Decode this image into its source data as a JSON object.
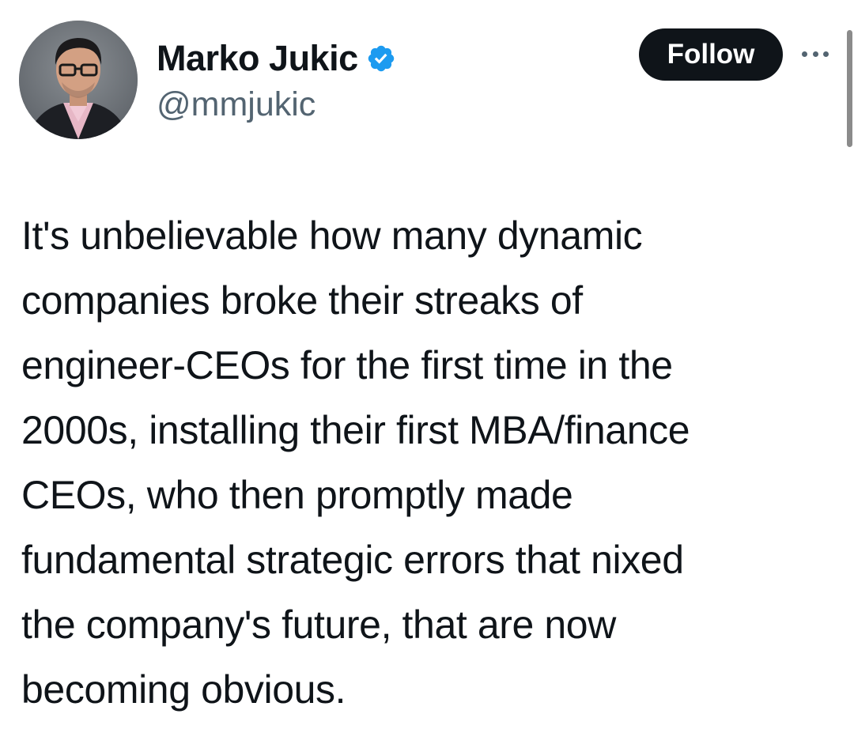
{
  "author": {
    "display_name": "Marko Jukic",
    "handle": "@mmjukic",
    "verified": true,
    "verified_icon": "verified-badge-icon",
    "verified_color": "#1d9bf0"
  },
  "actions": {
    "follow_label": "Follow",
    "more_icon": "more-horizontal-icon"
  },
  "tweet": {
    "lines": [
      "It's unbelievable how many dynamic",
      "companies broke their streaks of",
      "engineer-CEOs for the first time in the",
      "2000s, installing their first MBA/finance",
      "CEOs, who then promptly made",
      "fundamental strategic errors that nixed",
      "the company's future, that are now",
      "becoming obvious."
    ]
  },
  "colors": {
    "text": "#0f1419",
    "secondary": "#536471",
    "follow_bg": "#0f1419",
    "follow_text": "#ffffff",
    "background": "#ffffff"
  }
}
